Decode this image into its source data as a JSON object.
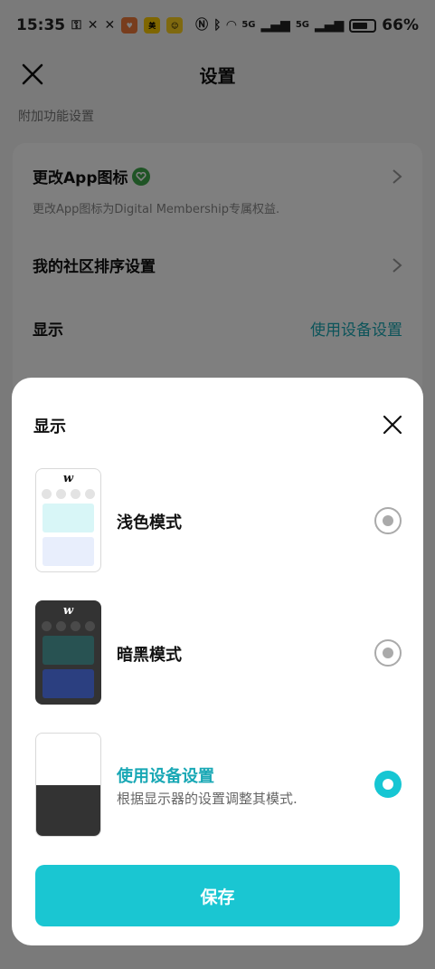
{
  "status_bar": {
    "time": "15:35",
    "battery": "66%",
    "network_label_1": "5G",
    "network_label_2": "5G"
  },
  "nav": {
    "title": "设置"
  },
  "section_label": "附加功能设置",
  "settings": [
    {
      "title": "更改App图标",
      "subtitle": "更改App图标为Digital Membership专属权益."
    },
    {
      "title": "我的社区排序设置"
    },
    {
      "title": "显示",
      "value": "使用设备设置"
    }
  ],
  "sheet": {
    "title": "显示",
    "options": [
      {
        "label": "浅色模式",
        "selected": false
      },
      {
        "label": "暗黑模式",
        "selected": false
      },
      {
        "label": "使用设备设置",
        "description": "根据显示器的设置调整其模式.",
        "selected": true
      }
    ],
    "thumb_logo": "w",
    "save_label": "保存"
  },
  "colors": {
    "accent": "#1ac6d2",
    "accent_text": "#19a8b5",
    "verified": "#3fa84a"
  }
}
